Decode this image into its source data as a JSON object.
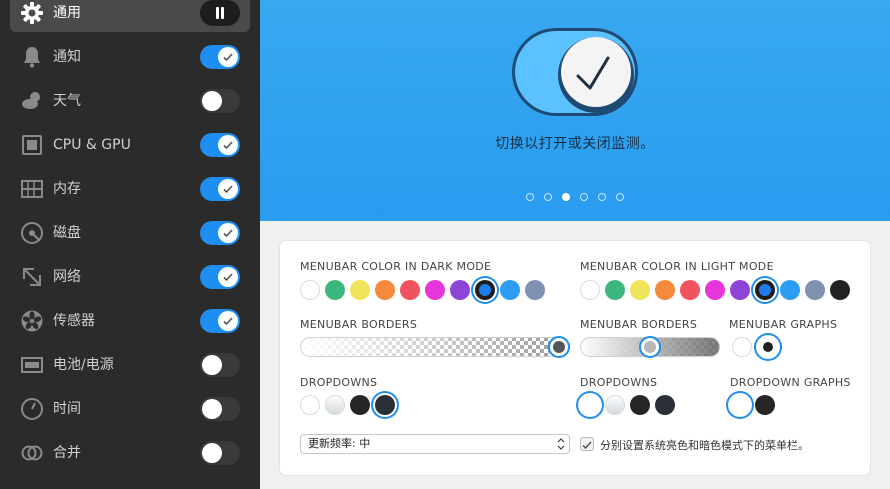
{
  "sidebar": {
    "items": [
      {
        "label": "通用",
        "icon": "gear-icon",
        "control": "pause"
      },
      {
        "label": "通知",
        "icon": "bell-icon",
        "control": "toggle",
        "on": true
      },
      {
        "label": "天气",
        "icon": "weather-icon",
        "control": "toggle",
        "on": false
      },
      {
        "label": "CPU & GPU",
        "icon": "cpu-icon",
        "control": "toggle",
        "on": true
      },
      {
        "label": "内存",
        "icon": "memory-icon",
        "control": "toggle",
        "on": true
      },
      {
        "label": "磁盘",
        "icon": "disk-icon",
        "control": "toggle",
        "on": true
      },
      {
        "label": "网络",
        "icon": "network-arrows-icon",
        "control": "toggle",
        "on": true
      },
      {
        "label": "传感器",
        "icon": "fan-icon",
        "control": "toggle",
        "on": true
      },
      {
        "label": "电池/电源",
        "icon": "battery-icon",
        "control": "toggle",
        "on": false
      },
      {
        "label": "时间",
        "icon": "clock-icon",
        "control": "toggle",
        "on": false
      },
      {
        "label": "合并",
        "icon": "combine-rings-icon",
        "control": "toggle",
        "on": false
      }
    ]
  },
  "hero": {
    "caption": "切换以打开或关闭监测。",
    "dots": 6,
    "active_dot": 3
  },
  "panel": {
    "dark_colors_label": "MENUBAR COLOR IN DARK MODE",
    "light_colors_label": "MENUBAR COLOR IN LIGHT MODE",
    "dark_borders_label": "MENUBAR BORDERS",
    "light_borders_label": "MENUBAR BORDERS",
    "graphs_label": "MENUBAR GRAPHS",
    "dark_dropdowns_label": "DROPDOWNS",
    "light_dropdowns_label": "DROPDOWNS",
    "dropdown_graphs_label": "DROPDOWN GRAPHS",
    "update_frequency": "更新频率: 中",
    "separate_modes_label": "分别设置系统亮色和暗色模式下的菜单栏。",
    "dark_colors": [
      "#ffffff",
      "#3cb77d",
      "#f0e45a",
      "#f58a3c",
      "#f0525f",
      "#e635d9",
      "#8e44d6",
      "#1e7ef0",
      "#2d9cf5",
      "#8090b0"
    ],
    "dark_selected": 7,
    "light_colors": [
      "#ffffff",
      "#3cb77d",
      "#f0e45a",
      "#f58a3c",
      "#f0525f",
      "#e635d9",
      "#8e44d6",
      "#1e7ef0",
      "#2d9cf5",
      "#8090b0",
      "#222222"
    ],
    "light_selected": 7,
    "dark_border_level": 1.0,
    "light_border_level": 0.5
  },
  "colors": {
    "accent": "#1e8ef0",
    "sidebar_bg": "#2b2b2b",
    "hero_bg": "#2a9cf0"
  }
}
